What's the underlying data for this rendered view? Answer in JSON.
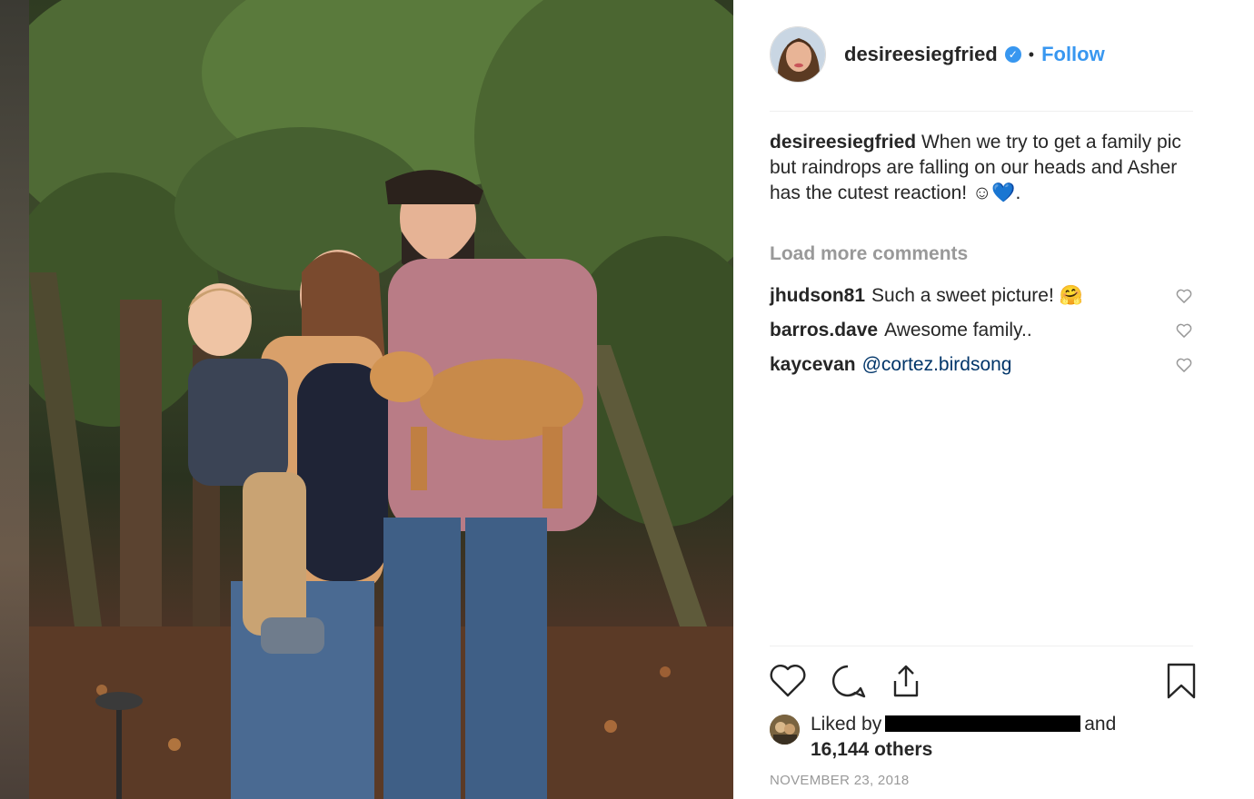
{
  "post": {
    "username": "desireesiegfried",
    "follow_label": "Follow",
    "separator": "•",
    "caption": "When we try to get a family pic but raindrops are falling on our heads and Asher has the cutest reaction! ☺💙.",
    "load_more": "Load more comments",
    "comments": [
      {
        "user": "jhudson81",
        "text": "Such a sweet picture! 🤗"
      },
      {
        "user": "barros.dave",
        "text": "Awesome family.."
      },
      {
        "user": "kaycevan",
        "text": "@cortez.birdsong"
      }
    ],
    "likes": {
      "prefix": "Liked by",
      "suffix": "and",
      "count": "16,144 others"
    },
    "date": "NOVEMBER 23, 2018"
  },
  "icons": {
    "verified": "verified-badge-icon",
    "like": "heart-icon",
    "comment": "comment-bubble-icon",
    "share": "share-icon",
    "save": "bookmark-icon"
  },
  "colors": {
    "link_blue": "#3897f0",
    "mention_blue": "#003569",
    "muted_gray": "#999999",
    "text": "#262626"
  }
}
